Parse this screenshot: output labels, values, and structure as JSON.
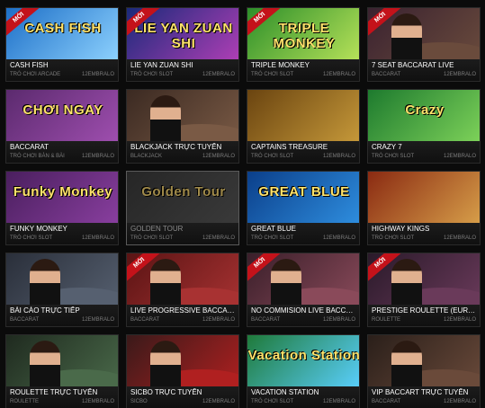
{
  "colors": {
    "badge": "#c4121a",
    "caption_bg": "#141414",
    "name_text": "#ffffff",
    "meta_text": "#7c7c7c"
  },
  "games": [
    {
      "name": "CASH FISH",
      "category": "TRÒ CHƠI ARCADE",
      "provider": "12EMBRALO",
      "badge": "MỚI",
      "art_text": "CASH FISH",
      "art_colors": [
        "#1d6fc7",
        "#8fd3ff"
      ],
      "dim": false
    },
    {
      "name": "LIE YAN ZUAN SHI",
      "category": "TRÒ CHƠI SLOT",
      "provider": "12EMBRALO",
      "badge": "MỚI",
      "art_text": "LIE YAN ZUAN SHI",
      "art_colors": [
        "#1a2a7a",
        "#b13fb6"
      ],
      "dim": false
    },
    {
      "name": "TRIPLE MONKEY",
      "category": "TRÒ CHƠI SLOT",
      "provider": "12EMBRALO",
      "badge": "MỚI",
      "art_text": "TRIPLE MONKEY",
      "art_colors": [
        "#2d8f2a",
        "#b9e35a"
      ],
      "dim": false
    },
    {
      "name": "7 SEAT BACCARAT LIVE",
      "category": "BACCARAT",
      "provider": "12EMBRALO",
      "badge": "MỚI",
      "art_text": "",
      "art_colors": [
        "#3a2230",
        "#6a4b3c"
      ],
      "dim": false,
      "live": true
    },
    {
      "name": "BACCARAT",
      "category": "TRÒ CHƠI BÀN & BÀI",
      "provider": "12EMBRALO",
      "badge": "",
      "art_text": "CHƠI NGAY",
      "art_colors": [
        "#5b2a6e",
        "#a04fb0"
      ],
      "dim": false
    },
    {
      "name": "BLACKJACK TRỰC TUYẾN",
      "category": "BLACKJACK",
      "provider": "12EMBRALO",
      "badge": "",
      "art_text": "",
      "art_colors": [
        "#3b2a22",
        "#7a5a45"
      ],
      "dim": false,
      "live": true
    },
    {
      "name": "CAPTAINS TREASURE",
      "category": "TRÒ CHƠI SLOT",
      "provider": "12EMBRALO",
      "badge": "",
      "art_text": "",
      "art_colors": [
        "#6a4410",
        "#c79a3a"
      ],
      "dim": false
    },
    {
      "name": "CRAZY 7",
      "category": "TRÒ CHƠI SLOT",
      "provider": "12EMBRALO",
      "badge": "",
      "art_text": "Crazy",
      "art_colors": [
        "#1d7a2e",
        "#7fd35a"
      ],
      "dim": false
    },
    {
      "name": "FUNKY MONKEY",
      "category": "TRÒ CHƠI SLOT",
      "provider": "12EMBRALO",
      "badge": "",
      "art_text": "Funky Monkey",
      "art_colors": [
        "#4a1f5e",
        "#8a3fa0"
      ],
      "dim": false
    },
    {
      "name": "GOLDEN TOUR",
      "category": "TRÒ CHƠI SLOT",
      "provider": "12EMBRALO",
      "badge": "",
      "art_text": "Golden Tour",
      "art_colors": [
        "#262626",
        "#3a3a3a"
      ],
      "dim": true
    },
    {
      "name": "GREAT BLUE",
      "category": "TRÒ CHƠI SLOT",
      "provider": "12EMBRALO",
      "badge": "",
      "art_text": "GREAT BLUE",
      "art_colors": [
        "#0b3f8a",
        "#2f8fe0"
      ],
      "dim": false
    },
    {
      "name": "HIGHWAY KINGS",
      "category": "TRÒ CHƠI SLOT",
      "provider": "12EMBRALO",
      "badge": "",
      "art_text": "",
      "art_colors": [
        "#8a2a12",
        "#d8a04a"
      ],
      "dim": false
    },
    {
      "name": "BÀI CÀO TRỰC TIẾP",
      "category": "BACCARAT",
      "provider": "12EMBRALO",
      "badge": "",
      "art_text": "",
      "art_colors": [
        "#2a2f3a",
        "#566070"
      ],
      "dim": false,
      "live": true
    },
    {
      "name": "LIVE PROGRESSIVE BACCARAT",
      "category": "BACCARAT",
      "provider": "12EMBRALO",
      "badge": "MỚI",
      "art_text": "",
      "art_colors": [
        "#5a1414",
        "#a83232"
      ],
      "dim": false,
      "live": true
    },
    {
      "name": "NO COMMISION LIVE BACCAR...",
      "category": "BACCARAT",
      "provider": "12EMBRALO",
      "badge": "MỚI",
      "art_text": "",
      "art_colors": [
        "#3a1f2a",
        "#8a4a5a"
      ],
      "dim": false,
      "live": true
    },
    {
      "name": "PRESTIGE ROULETTE (EURO LI...",
      "category": "ROULETTE",
      "provider": "12EMBRALO",
      "badge": "MỚI",
      "art_text": "",
      "art_colors": [
        "#2a1a2a",
        "#6a3a5a"
      ],
      "dim": false,
      "live": true
    },
    {
      "name": "ROULETTE TRỰC TUYẾN",
      "category": "ROULETTE",
      "provider": "12EMBRALO",
      "badge": "",
      "art_text": "",
      "art_colors": [
        "#1f2a1f",
        "#4a6a4a"
      ],
      "dim": false,
      "live": true
    },
    {
      "name": "SICBO TRỰC TUYẾN",
      "category": "SICBO",
      "provider": "12EMBRALO",
      "badge": "",
      "art_text": "",
      "art_colors": [
        "#3a1a1a",
        "#b02020"
      ],
      "dim": false,
      "live": true
    },
    {
      "name": "VACATION STATION",
      "category": "TRÒ CHƠI SLOT",
      "provider": "12EMBRALO",
      "badge": "",
      "art_text": "Vacation Station",
      "art_colors": [
        "#1f7a3a",
        "#5ad0ff"
      ],
      "dim": false
    },
    {
      "name": "VIP BACCART TRỰC TUYẾN",
      "category": "BACCARAT",
      "provider": "12EMBRALO",
      "badge": "",
      "art_text": "",
      "art_colors": [
        "#2a1f1a",
        "#6a4a3a"
      ],
      "dim": false,
      "live": true
    }
  ]
}
